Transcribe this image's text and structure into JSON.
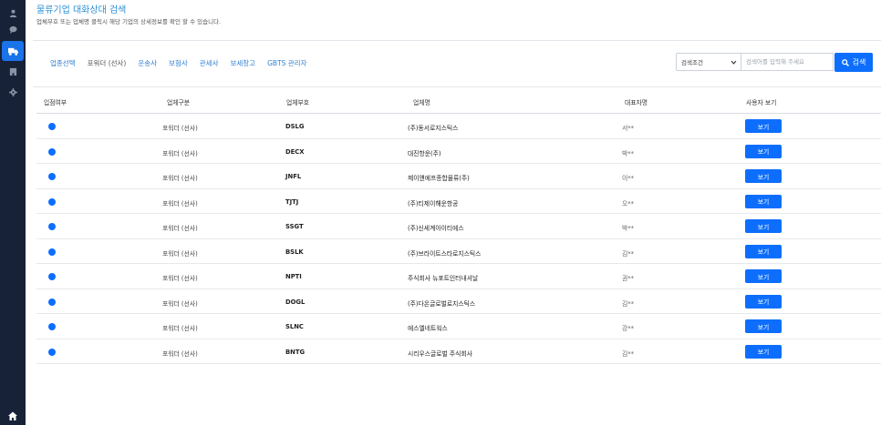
{
  "sidebar": {
    "items": [
      {
        "icon": "user-icon"
      },
      {
        "icon": "chat-icon"
      },
      {
        "icon": "truck-icon",
        "active": true
      },
      {
        "icon": "building-icon"
      },
      {
        "icon": "gear-icon"
      },
      {
        "icon": "home-icon"
      }
    ]
  },
  "header": {
    "title": "물류기업 대화상대 검색",
    "subtitle": "업체부호 또는 업체명 클릭시 해당 기업의 상세정보를 확인 할 수 있습니다."
  },
  "filters": {
    "tabs": [
      {
        "label": "업종선택"
      },
      {
        "label": "포워더 (선사)"
      },
      {
        "label": "운송사"
      },
      {
        "label": "보험사"
      },
      {
        "label": "관세사"
      },
      {
        "label": "보세창고"
      },
      {
        "label": "GBTS 관리자"
      }
    ]
  },
  "search": {
    "select_value": "검색조건",
    "placeholder": "검색어를 입력해 주세요",
    "button_label": "검색"
  },
  "table": {
    "headers": {
      "status": "입점여부",
      "type": "업체구분",
      "code": "업체부호",
      "name": "업체명",
      "rep": "대표자명",
      "view": "사용자 보기"
    },
    "rows": [
      {
        "type": "포워더 (선사)",
        "code": "DSLG",
        "name": "(주)동서로지스틱스",
        "rep": "서**",
        "view": "보기"
      },
      {
        "type": "포워더 (선사)",
        "code": "DECX",
        "name": "대진항운(주)",
        "rep": "박**",
        "view": "보기"
      },
      {
        "type": "포워더 (선사)",
        "code": "JNFL",
        "name": "제이앤에프종합물류(주)",
        "rep": "이**",
        "view": "보기"
      },
      {
        "type": "포워더 (선사)",
        "code": "TJTJ",
        "name": "(주)티제이해운항공",
        "rep": "오**",
        "view": "보기"
      },
      {
        "type": "포워더 (선사)",
        "code": "SSGT",
        "name": "(주)신세계아이티에스",
        "rep": "박**",
        "view": "보기"
      },
      {
        "type": "포워더 (선사)",
        "code": "BSLK",
        "name": "(주)브라이트스타로지스틱스",
        "rep": "김**",
        "view": "보기"
      },
      {
        "type": "포워더 (선사)",
        "code": "NPTI",
        "name": "주식회사 뉴포트인터내셔날",
        "rep": "권**",
        "view": "보기"
      },
      {
        "type": "포워더 (선사)",
        "code": "DOGL",
        "name": "(주)다온글로벌로지스틱스",
        "rep": "김**",
        "view": "보기"
      },
      {
        "type": "포워더 (선사)",
        "code": "SLNC",
        "name": "에스엘네트웍스",
        "rep": "강**",
        "view": "보기"
      },
      {
        "type": "포워더 (선사)",
        "code": "BNTG",
        "name": "시리우스글로벌 주식회사",
        "rep": "김**",
        "view": "보기"
      }
    ]
  },
  "colors": {
    "accent": "#0d6efd",
    "sidebar": "#172238",
    "title": "#2b8fd6"
  }
}
